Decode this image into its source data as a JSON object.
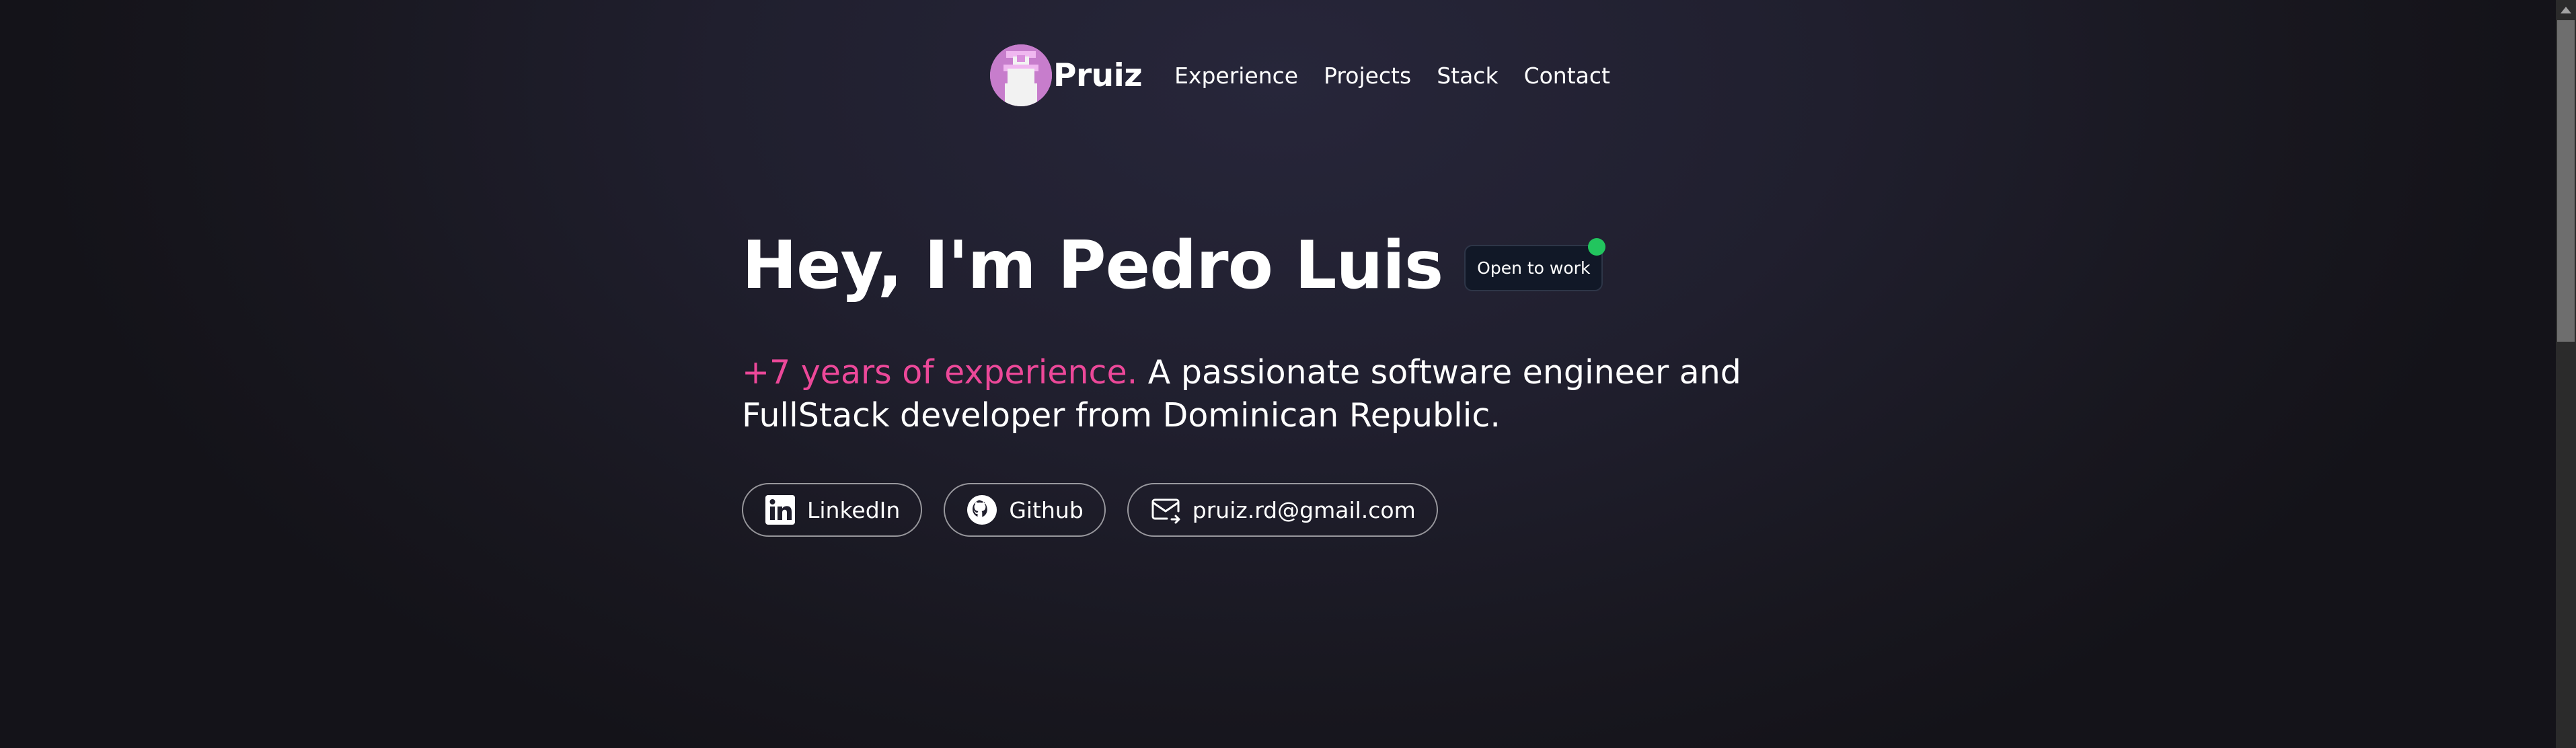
{
  "nav": {
    "brand": "Pruiz",
    "links": [
      {
        "label": "Experience"
      },
      {
        "label": "Projects"
      },
      {
        "label": "Stack"
      },
      {
        "label": "Contact"
      }
    ]
  },
  "hero": {
    "title": "Hey, I'm Pedro Luis",
    "badge": "Open to work",
    "highlight": "+7 years of experience.",
    "description": " A passionate software engineer and FullStack developer from Dominican Republic.",
    "links": [
      {
        "label": "LinkedIn",
        "icon": "linkedin-icon"
      },
      {
        "label": "Github",
        "icon": "github-icon"
      },
      {
        "label": "pruiz.rd@gmail.com",
        "icon": "mail-icon"
      }
    ]
  },
  "colors": {
    "accent": "#ec4899",
    "status": "#22c55e",
    "background": "#1f1e2c"
  }
}
